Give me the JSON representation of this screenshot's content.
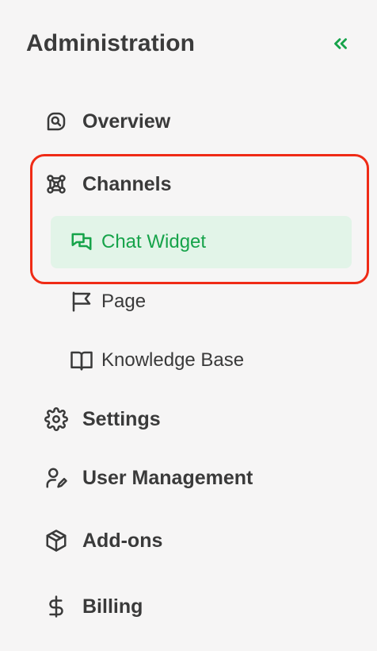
{
  "header": {
    "title": "Administration",
    "collapse_icon": "chevrons-left-icon"
  },
  "colors": {
    "accent": "#16a34a",
    "active_background": "#e2f4e8",
    "highlight": "#ef2b16",
    "text": "#3a3a3a"
  },
  "nav": {
    "overview": {
      "label": "Overview",
      "icon": "overview-icon"
    },
    "channels": {
      "label": "Channels",
      "icon": "channels-icon",
      "children": {
        "chat_widget": {
          "label": "Chat Widget",
          "icon": "chat-bubbles-icon",
          "active": true
        },
        "page": {
          "label": "Page",
          "icon": "flag-icon"
        },
        "knowledge_base": {
          "label": "Knowledge Base",
          "icon": "book-icon"
        }
      }
    },
    "settings": {
      "label": "Settings",
      "icon": "gear-icon"
    },
    "user_management": {
      "label": "User Management",
      "icon": "user-edit-icon"
    },
    "add_ons": {
      "label": "Add-ons",
      "icon": "package-icon"
    },
    "billing": {
      "label": "Billing",
      "icon": "dollar-icon"
    }
  }
}
